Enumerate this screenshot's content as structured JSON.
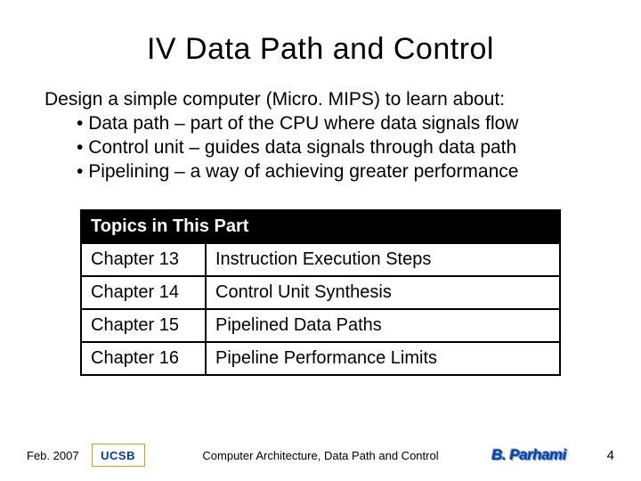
{
  "title": "IV  Data Path and Control",
  "intro": {
    "lead": "Design a simple computer (Micro. MIPS) to learn about:",
    "bullets": [
      "Data path – part of the CPU where data signals flow",
      "Control unit – guides data signals through data path",
      "Pipelining – a way of achieving greater performance"
    ]
  },
  "topics": {
    "header": "Topics in This Part",
    "rows": [
      {
        "chapter": "Chapter 13",
        "title": "Instruction Execution Steps"
      },
      {
        "chapter": "Chapter 14",
        "title": "Control Unit Synthesis"
      },
      {
        "chapter": "Chapter 15",
        "title": "Pipelined Data Paths"
      },
      {
        "chapter": "Chapter 16",
        "title": "Pipeline Performance Limits"
      }
    ]
  },
  "footer": {
    "date": "Feb. 2007",
    "logo_text": "UCSB",
    "center": "Computer Architecture, Data Path and Control",
    "author": "B. Parhami",
    "page": "4"
  }
}
